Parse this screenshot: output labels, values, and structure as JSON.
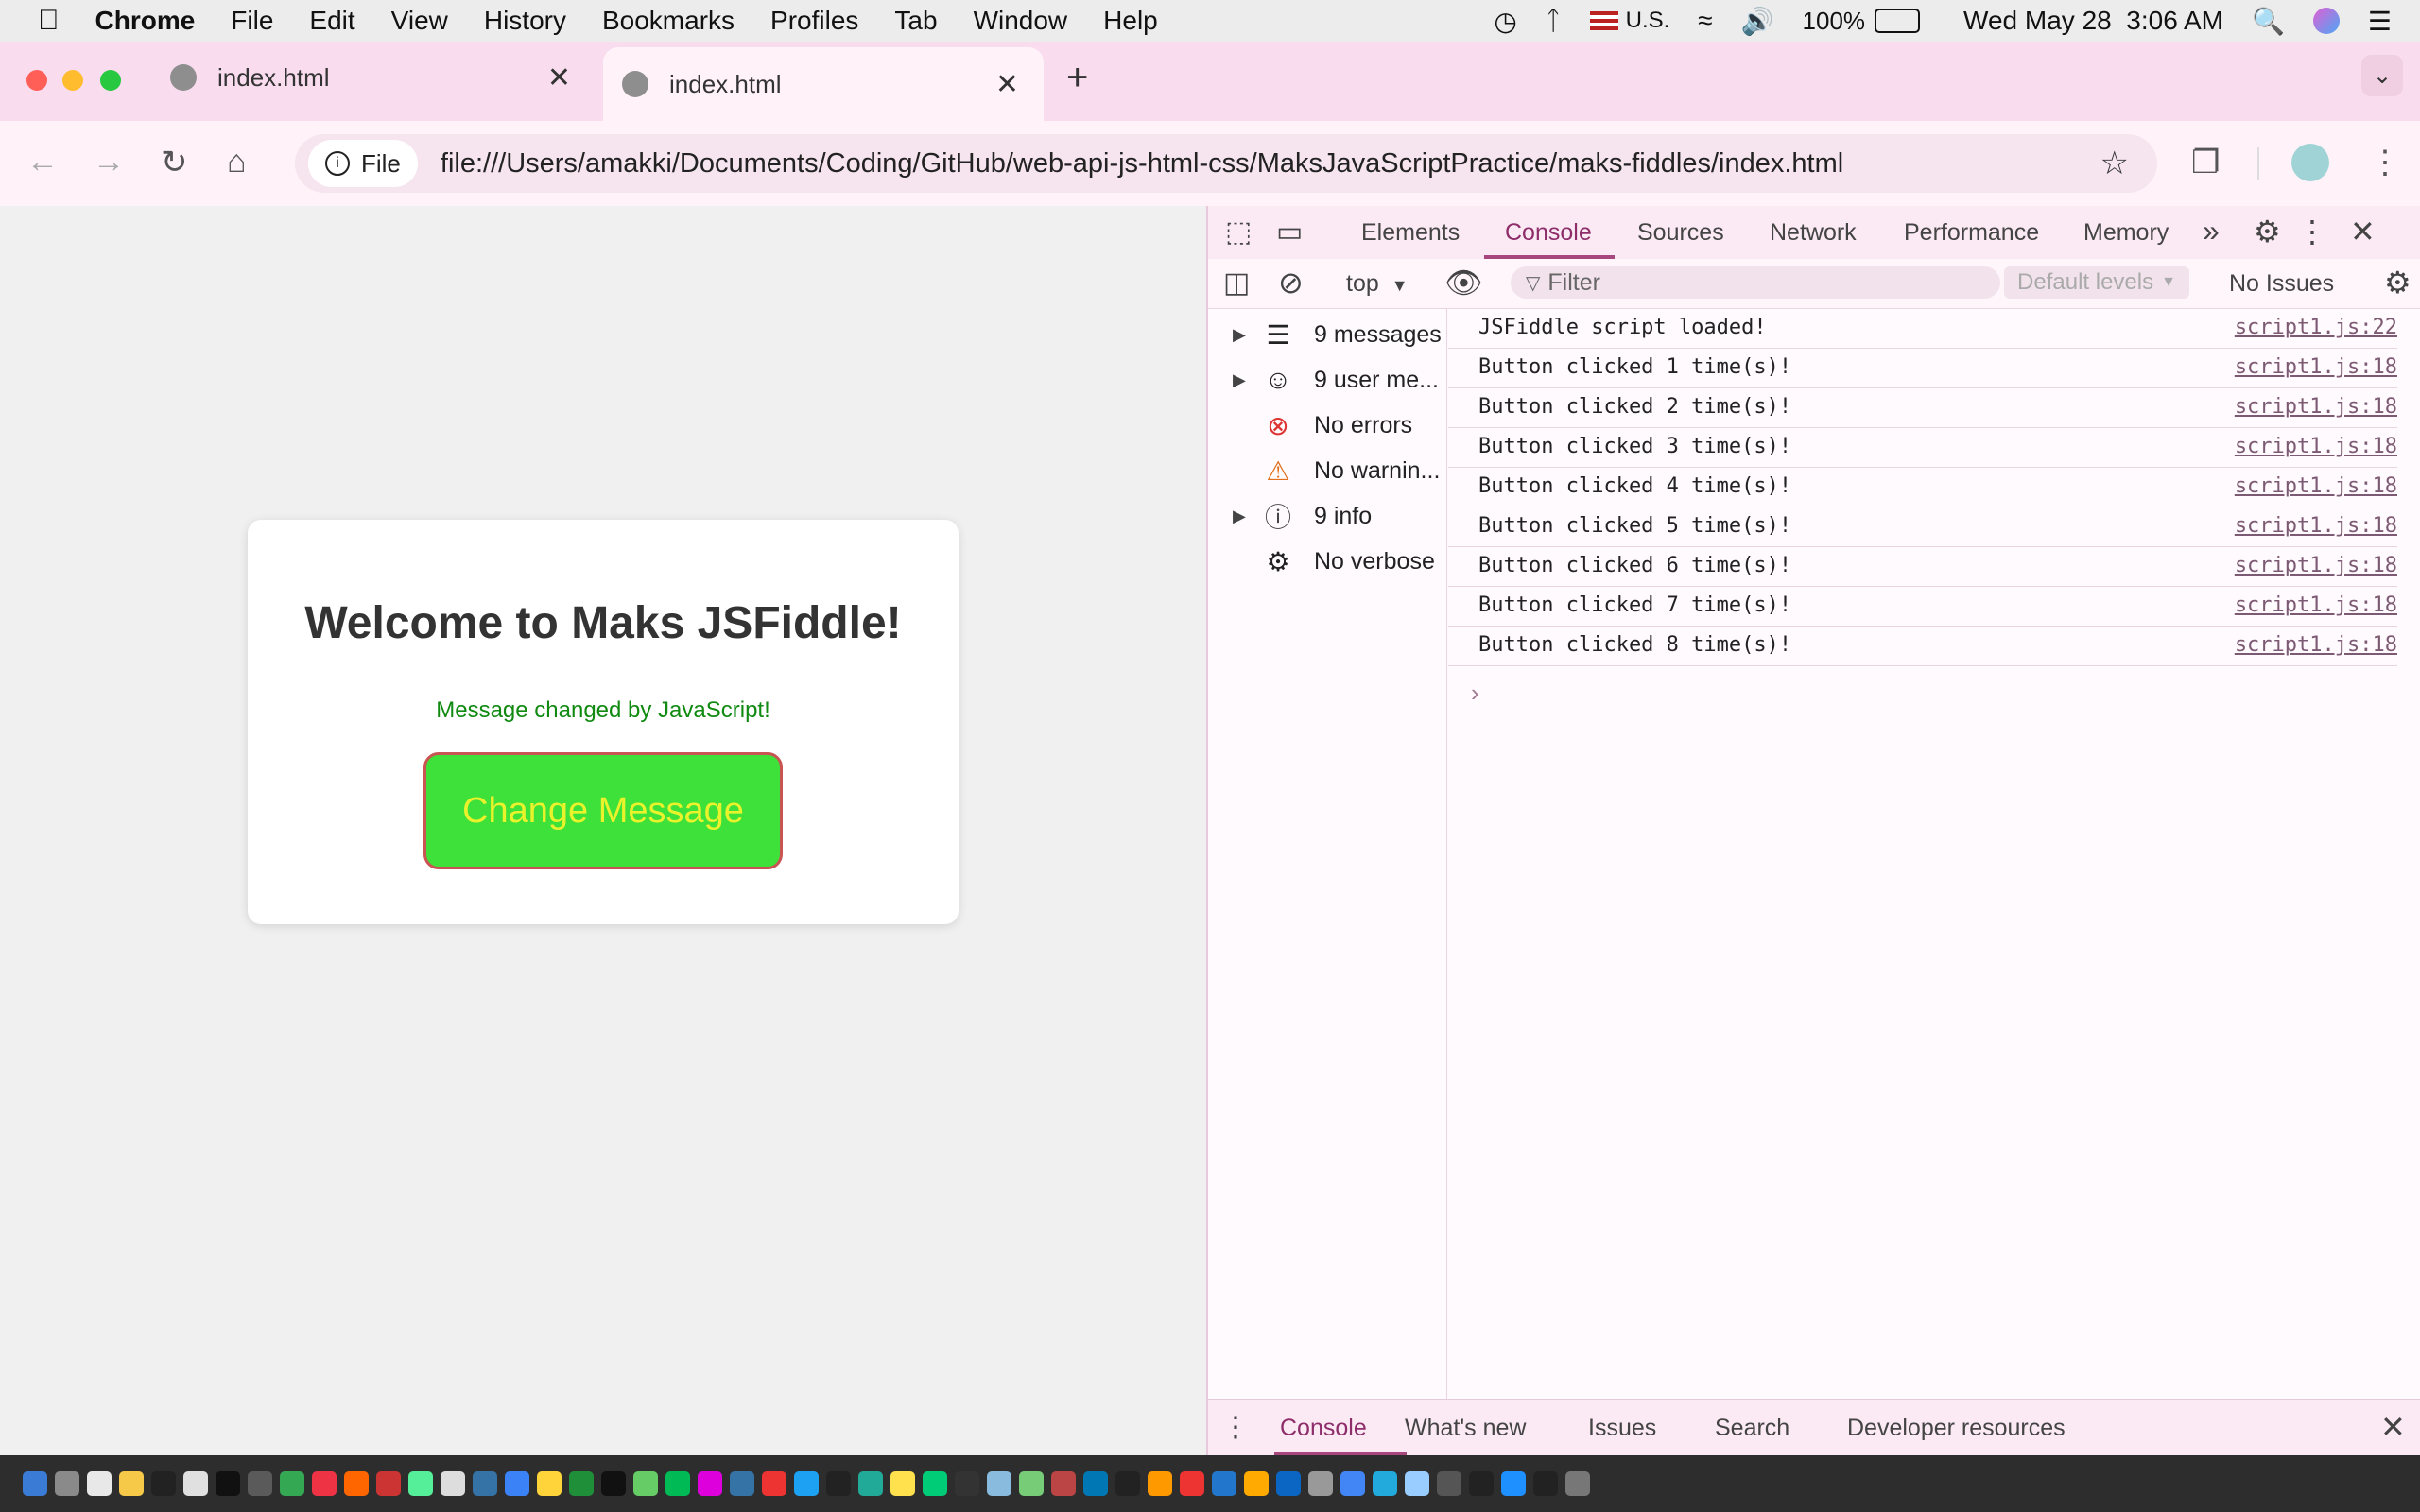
{
  "menubar": {
    "app": "Chrome",
    "items": [
      "File",
      "Edit",
      "View",
      "History",
      "Bookmarks",
      "Profiles",
      "Tab",
      "Window",
      "Help"
    ],
    "input_source": "U.S.",
    "battery": "100%",
    "datetime": "Wed May 28  3:06 AM"
  },
  "tabs": [
    {
      "title": "index.html",
      "active": false
    },
    {
      "title": "index.html",
      "active": true
    }
  ],
  "toolbar": {
    "chip": "File",
    "url": "file:///Users/amakki/Documents/Coding/GitHub/web-api-js-html-css/MaksJavaScriptPractice/maks-fiddles/index.html"
  },
  "page": {
    "heading": "Welcome to Maks JSFiddle!",
    "message": "Message changed by JavaScript!",
    "button_label": "Change Message"
  },
  "devtools": {
    "tabs": [
      "Elements",
      "Console",
      "Sources",
      "Network",
      "Performance",
      "Memory"
    ],
    "context": "top",
    "filter_placeholder": "Filter",
    "levels": "Default levels",
    "issues": "No Issues",
    "sidebar": [
      {
        "label": "9 messages",
        "icon": "list-icon",
        "expandable": true
      },
      {
        "label": "9 user me...",
        "icon": "user-icon",
        "expandable": true
      },
      {
        "label": "No errors",
        "icon": "error-icon",
        "expandable": false
      },
      {
        "label": "No warnin...",
        "icon": "warning-icon",
        "expandable": false
      },
      {
        "label": "9 info",
        "icon": "info-icon",
        "expandable": true
      },
      {
        "label": "No verbose",
        "icon": "bug-icon",
        "expandable": false
      }
    ],
    "logs": [
      {
        "text": "JSFiddle script loaded!",
        "source": "script1.js:22"
      },
      {
        "text": "Button clicked 1 time(s)!",
        "source": "script1.js:18"
      },
      {
        "text": "Button clicked 2 time(s)!",
        "source": "script1.js:18"
      },
      {
        "text": "Button clicked 3 time(s)!",
        "source": "script1.js:18"
      },
      {
        "text": "Button clicked 4 time(s)!",
        "source": "script1.js:18"
      },
      {
        "text": "Button clicked 5 time(s)!",
        "source": "script1.js:18"
      },
      {
        "text": "Button clicked 6 time(s)!",
        "source": "script1.js:18"
      },
      {
        "text": "Button clicked 7 time(s)!",
        "source": "script1.js:18"
      },
      {
        "text": "Button clicked 8 time(s)!",
        "source": "script1.js:18"
      }
    ],
    "drawer_tabs": [
      "Console",
      "What's new",
      "Issues",
      "Search",
      "Developer resources"
    ]
  },
  "colors": {
    "button_bg": "#3ee03a",
    "button_text": "#e9f22a",
    "message_text": "#108a10",
    "devtools_accent": "#a8467e"
  }
}
